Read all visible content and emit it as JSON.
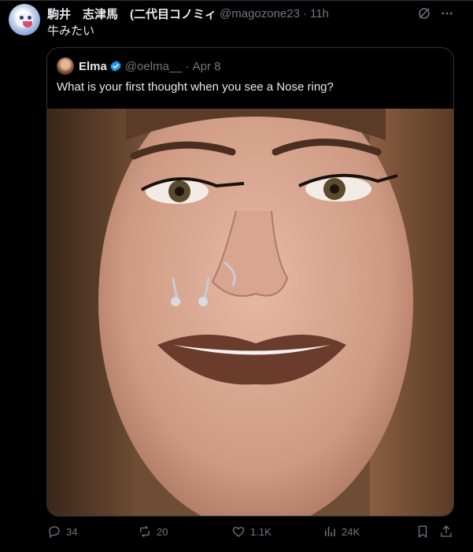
{
  "tweet": {
    "display_name": "駒井　志津馬　(二代目コノミィ",
    "handle": "@magozone23",
    "separator": "·",
    "time": "11h",
    "text": "牛みたい"
  },
  "quote": {
    "display_name": "Elma",
    "handle": "@oelma__",
    "separator": "·",
    "date": "Apr 8",
    "text": "What is your first thought when you see a Nose ring?",
    "image_alt": "Close-up photo of a woman with a septum ring and nostril hoop"
  },
  "actions": {
    "replies": "34",
    "reposts": "20",
    "likes": "1.1K",
    "views": "24K"
  },
  "icons": {
    "grok": "grok-icon",
    "more": "more-icon",
    "reply": "reply-icon",
    "repost": "repost-icon",
    "like": "heart-icon",
    "views": "views-icon",
    "bookmark": "bookmark-icon",
    "share": "share-icon",
    "verified": "verified-badge-icon"
  },
  "colors": {
    "background": "#000000",
    "text": "#e7e9ea",
    "secondary": "#71767b",
    "border": "#2f3336",
    "verified": "#1d9bf0"
  }
}
